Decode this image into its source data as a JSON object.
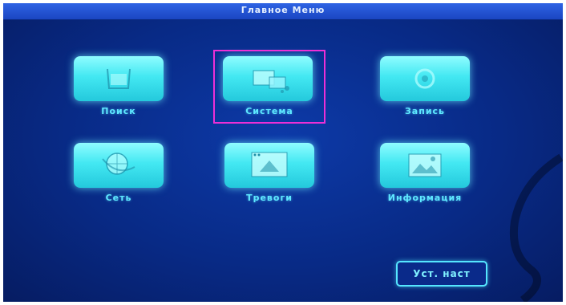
{
  "window": {
    "title": "Главное Меню"
  },
  "menu": {
    "items": [
      {
        "label": "Поиск",
        "icon": "search-icon",
        "selected": false
      },
      {
        "label": "Система",
        "icon": "system-icon",
        "selected": true
      },
      {
        "label": "Запись",
        "icon": "record-icon",
        "selected": false
      },
      {
        "label": "Сеть",
        "icon": "network-icon",
        "selected": false
      },
      {
        "label": "Тревоги",
        "icon": "alarm-icon",
        "selected": false
      },
      {
        "label": "Информация",
        "icon": "info-icon",
        "selected": false
      }
    ]
  },
  "footer": {
    "setup_button_label": "Уст. наст"
  },
  "colors": {
    "background": "#082a86",
    "tile": "#43e8f2",
    "label": "#5ee8ff",
    "selection": "#ee2fd6"
  }
}
